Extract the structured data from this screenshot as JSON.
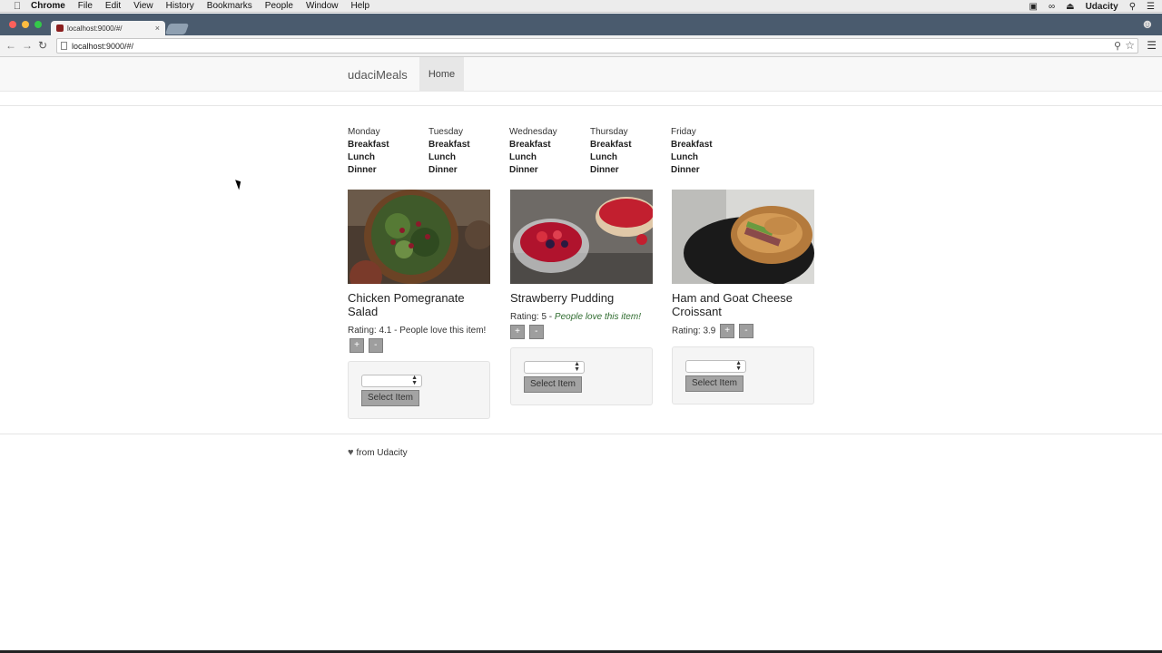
{
  "menubar": {
    "app": "Chrome",
    "items": [
      "File",
      "Edit",
      "View",
      "History",
      "Bookmarks",
      "People",
      "Window",
      "Help"
    ],
    "user": "Udacity"
  },
  "browser": {
    "tab_title": "localhost:9000/#/",
    "url": "localhost:9000/#/"
  },
  "site": {
    "brand": "udaciMeals",
    "nav_home": "Home"
  },
  "week": [
    {
      "day": "Monday",
      "meals": [
        "Breakfast",
        "Lunch",
        "Dinner"
      ]
    },
    {
      "day": "Tuesday",
      "meals": [
        "Breakfast",
        "Lunch",
        "Dinner"
      ]
    },
    {
      "day": "Wednesday",
      "meals": [
        "Breakfast",
        "Lunch",
        "Dinner"
      ]
    },
    {
      "day": "Thursday",
      "meals": [
        "Breakfast",
        "Lunch",
        "Dinner"
      ]
    },
    {
      "day": "Friday",
      "meals": [
        "Breakfast",
        "Lunch",
        "Dinner"
      ]
    }
  ],
  "items": [
    {
      "name": "Chicken Pomegranate Salad",
      "rating_label": "Rating: 4.1",
      "love": " - People love this item!",
      "love_italic": false,
      "select_label": "Select Item"
    },
    {
      "name": "Strawberry Pudding",
      "rating_label": "Rating: 5",
      "love_prefix": " - ",
      "love": "People love this item!",
      "love_italic": true,
      "select_label": "Select Item"
    },
    {
      "name": "Ham and Goat Cheese Croissant",
      "rating_label": "Rating: 3.9",
      "love": "",
      "love_italic": false,
      "select_label": "Select Item"
    }
  ],
  "buttons": {
    "plus": "+",
    "minus": "-"
  },
  "footer": {
    "text": "from Udacity"
  }
}
